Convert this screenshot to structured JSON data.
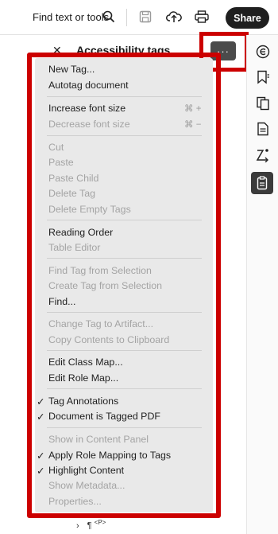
{
  "toolbar": {
    "find_label": "Find text or tools",
    "share_label": "Share",
    "icons": [
      "search-icon",
      "save-icon",
      "upload-icon",
      "print-icon"
    ]
  },
  "panel": {
    "close_glyph": "✕",
    "title": "Accessibility tags",
    "more_glyph": "···"
  },
  "rail": {
    "icons": [
      "comment-icon",
      "bookmark-icon",
      "pages-icon",
      "document-icon",
      "order-icon",
      "tags-icon"
    ]
  },
  "menu": {
    "new_tag": "New Tag...",
    "autotag": "Autotag document",
    "increase_font": "Increase font size",
    "increase_shortcut": "⌘ +",
    "decrease_font": "Decrease font size",
    "decrease_shortcut": "⌘ −",
    "cut": "Cut",
    "paste": "Paste",
    "paste_child": "Paste Child",
    "delete_tag": "Delete Tag",
    "delete_empty": "Delete Empty Tags",
    "reading_order": "Reading Order",
    "table_editor": "Table Editor",
    "find_tag": "Find Tag from Selection",
    "create_tag": "Create Tag from Selection",
    "find": "Find...",
    "change_artifact": "Change Tag to Artifact...",
    "copy_contents": "Copy Contents to Clipboard",
    "edit_class_map": "Edit Class Map...",
    "edit_role_map": "Edit Role Map...",
    "tag_annotations": "Tag Annotations",
    "document_tagged": "Document is Tagged PDF",
    "show_content": "Show in Content Panel",
    "apply_role_mapping": "Apply Role Mapping to Tags",
    "highlight_content": "Highlight Content",
    "show_metadata": "Show Metadata...",
    "properties": "Properties...",
    "check_glyph": "✓"
  },
  "tree": {
    "chevron": "›",
    "paragraph": "¶",
    "tag": "<P>"
  },
  "colors": {
    "highlight": "#cc0000",
    "menu_bg": "#e9e9e9",
    "disabled_text": "#a4a4a4"
  }
}
